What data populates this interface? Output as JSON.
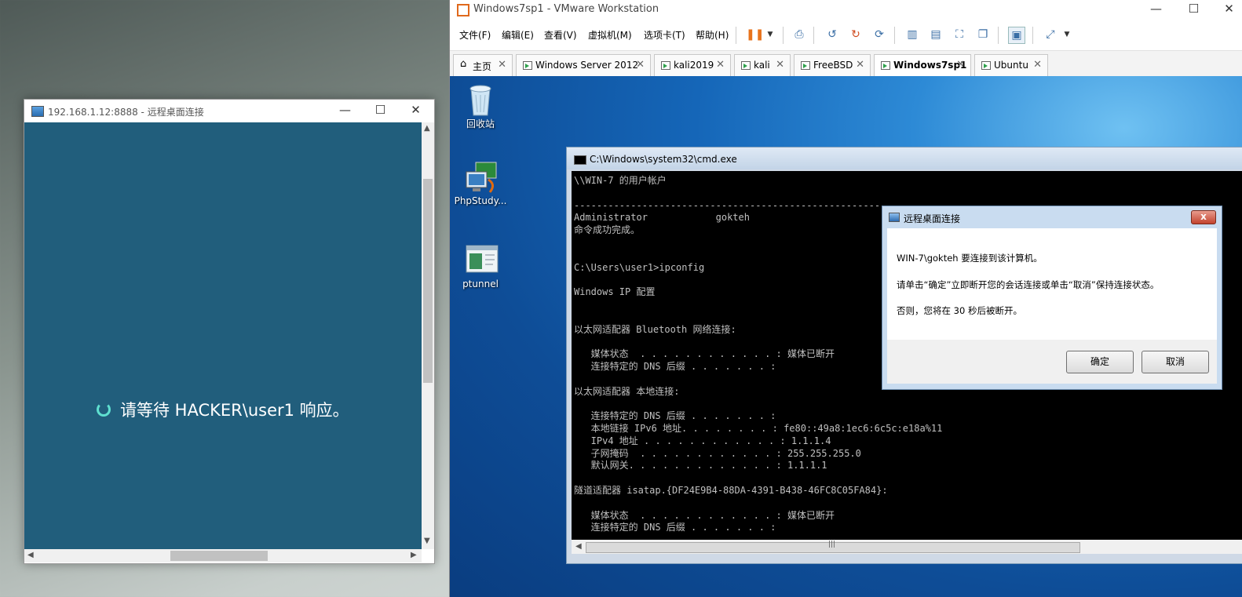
{
  "rdp": {
    "title": "192.168.1.12:8888 - 远程桌面连接",
    "wait_message": "请等待 HACKER\\user1 响应。",
    "minimize": "—",
    "maximize": "☐",
    "close": "✕"
  },
  "vmware": {
    "title": "Windows7sp1 - VMware Workstation",
    "menu": [
      "文件(F)",
      "编辑(E)",
      "查看(V)",
      "虚拟机(M)",
      "选项卡(T)",
      "帮助(H)"
    ],
    "tabs": [
      {
        "label": "主页"
      },
      {
        "label": "Windows Server 2012"
      },
      {
        "label": "kali2019"
      },
      {
        "label": "kali"
      },
      {
        "label": "FreeBSD"
      },
      {
        "label": "Windows7sp1"
      },
      {
        "label": "Ubuntu"
      }
    ],
    "active_tab": "Windows7sp1"
  },
  "guest": {
    "desktop_icons": [
      {
        "label": "回收站",
        "icon": "recycle-bin-icon"
      },
      {
        "label": "PhpStudy...",
        "icon": "phpstudy-icon"
      },
      {
        "label": "ptunnel",
        "icon": "ptunnel-icon"
      }
    ],
    "cmd": {
      "title": "C:\\Windows\\system32\\cmd.exe",
      "lines": [
        "\\\\WIN-7 的用户帐户",
        "",
        "-------------------------------------------------------------------------------",
        "Administrator            gokteh",
        "命令成功完成。",
        "",
        "",
        "C:\\Users\\user1>ipconfig",
        "",
        "Windows IP 配置",
        "",
        "",
        "以太网适配器 Bluetooth 网络连接:",
        "",
        "   媒体状态  . . . . . . . . . . . . : 媒体已断开",
        "   连接特定的 DNS 后缀 . . . . . . . :",
        "",
        "以太网适配器 本地连接:",
        "",
        "   连接特定的 DNS 后缀 . . . . . . . :",
        "   本地链接 IPv6 地址. . . . . . . . : fe80::49a8:1ec6:6c5c:e18a%11",
        "   IPv4 地址 . . . . . . . . . . . . : 1.1.1.4",
        "   子网掩码  . . . . . . . . . . . . : 255.255.255.0",
        "   默认网关. . . . . . . . . . . . . : 1.1.1.1",
        "",
        "隧道适配器 isatap.{DF24E9B4-88DA-4391-B438-46FC8C05FA84}:",
        "",
        "   媒体状态  . . . . . . . . . . . . : 媒体已断开",
        "   连接特定的 DNS 后缀 . . . . . . . :"
      ],
      "scroll_thumb_glyph": "|||"
    },
    "dialog": {
      "title": "远程桌面连接",
      "line1": "WIN-7\\gokteh 要连接到该计算机。",
      "line2": "请单击“确定”立即断开您的会话连接或单击“取消”保持连接状态。",
      "line3": "否则，您将在 30 秒后被断开。",
      "ok": "确定",
      "cancel": "取消",
      "close": "x"
    }
  }
}
